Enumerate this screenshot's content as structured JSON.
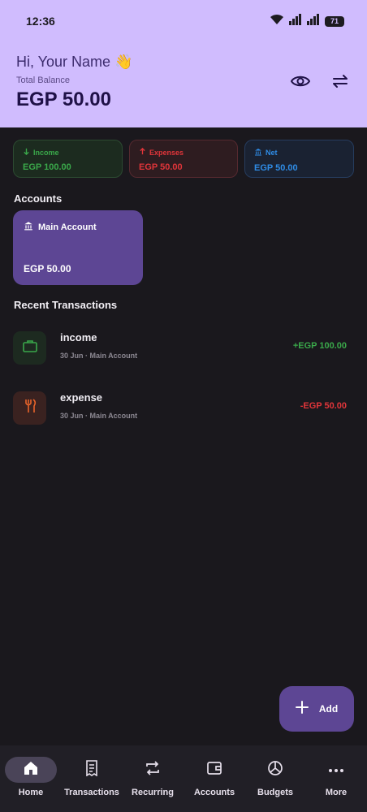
{
  "status_bar": {
    "time": "12:36",
    "battery": "71"
  },
  "header": {
    "greeting": "Hi, Your Name 👋",
    "balance_label": "Total Balance",
    "balance_value": "EGP 50.00"
  },
  "summary": {
    "income": {
      "label": "Income",
      "value": "EGP 100.00",
      "color": "#3aa84a"
    },
    "expenses": {
      "label": "Expenses",
      "value": "EGP 50.00",
      "color": "#e0353a"
    },
    "net": {
      "label": "Net",
      "value": "EGP 50.00",
      "color": "#2f8ce6"
    }
  },
  "accounts": {
    "title": "Accounts",
    "items": [
      {
        "name": "Main Account",
        "balance": "EGP 50.00"
      }
    ]
  },
  "recent": {
    "title": "Recent Transactions",
    "items": [
      {
        "title": "income",
        "subtitle": "30 Jun · Main Account",
        "amount": "+EGP 100.00",
        "icon": "briefcase-icon",
        "color": "#3aa84a"
      },
      {
        "title": "expense",
        "subtitle": "30 Jun · Main Account",
        "amount": "-EGP 50.00",
        "icon": "fork-knife-icon",
        "color": "#e0353a"
      }
    ]
  },
  "fab": {
    "label": "Add"
  },
  "nav": {
    "items": [
      {
        "label": "Home",
        "icon": "home-icon",
        "active": true
      },
      {
        "label": "Transactions",
        "icon": "receipt-icon"
      },
      {
        "label": "Recurring",
        "icon": "repeat-icon"
      },
      {
        "label": "Accounts",
        "icon": "wallet-icon"
      },
      {
        "label": "Budgets",
        "icon": "pie-chart-icon"
      },
      {
        "label": "More",
        "icon": "more-icon"
      }
    ]
  },
  "colors": {
    "header_bg": "#d0bcfe",
    "background": "#1a181d",
    "accent": "#5d4694",
    "nav_bg": "#211f26"
  }
}
